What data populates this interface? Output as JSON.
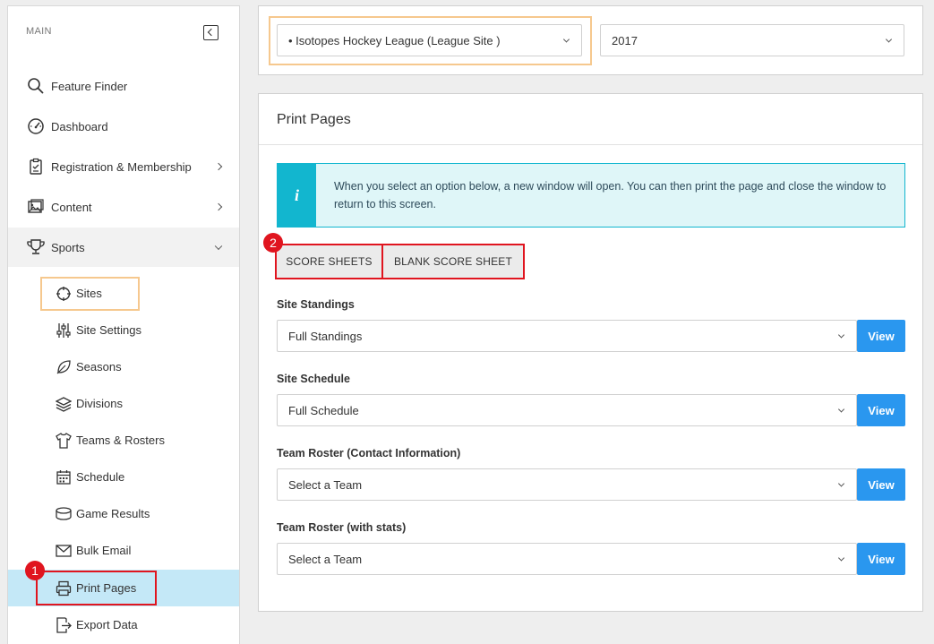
{
  "sidebar": {
    "header": "MAIN",
    "items": [
      {
        "label": "Feature Finder",
        "icon": "search-icon"
      },
      {
        "label": "Dashboard",
        "icon": "dashboard-gauge-icon"
      },
      {
        "label": "Registration & Membership",
        "icon": "clipboard-icon"
      },
      {
        "label": "Content",
        "icon": "image-gallery-icon"
      },
      {
        "label": "Sports",
        "icon": "trophy-icon"
      }
    ],
    "sub_items": [
      {
        "label": "Sites",
        "icon": "crosshair-icon"
      },
      {
        "label": "Site Settings",
        "icon": "sliders-icon"
      },
      {
        "label": "Seasons",
        "icon": "leaf-icon"
      },
      {
        "label": "Divisions",
        "icon": "layers-icon"
      },
      {
        "label": "Teams & Rosters",
        "icon": "jersey-icon"
      },
      {
        "label": "Schedule",
        "icon": "calendar-icon"
      },
      {
        "label": "Game Results",
        "icon": "database-icon"
      },
      {
        "label": "Bulk Email",
        "icon": "envelope-icon"
      },
      {
        "label": "Print Pages",
        "icon": "printer-icon"
      },
      {
        "label": "Export Data",
        "icon": "export-file-icon"
      }
    ]
  },
  "top": {
    "site_select": "• Isotopes Hockey League (League Site )",
    "year_select": "2017"
  },
  "print": {
    "title": "Print Pages",
    "info_icon": "i",
    "info_text": "When you select an option below, a new window will open. You can then print the page and close the window to return to this screen.",
    "tabs": [
      "SCORE SHEETS",
      "BLANK SCORE SHEET"
    ],
    "sections": [
      {
        "label": "Site Standings",
        "value": "Full Standings",
        "button": "View"
      },
      {
        "label": "Site Schedule",
        "value": "Full Schedule",
        "button": "View"
      },
      {
        "label": "Team Roster (Contact Information)",
        "value": "Select a Team",
        "button": "View"
      },
      {
        "label": "Team Roster (with stats)",
        "value": "Select a Team",
        "button": "View"
      }
    ]
  },
  "annotations": {
    "badge_1": "1",
    "badge_2": "2"
  },
  "colors": {
    "highlight_orange": "#f6c88e",
    "highlight_red": "#e0151f",
    "active_item": "#c4e8f7",
    "info_accent": "#12b6cf",
    "view_button": "#2a97ef"
  }
}
